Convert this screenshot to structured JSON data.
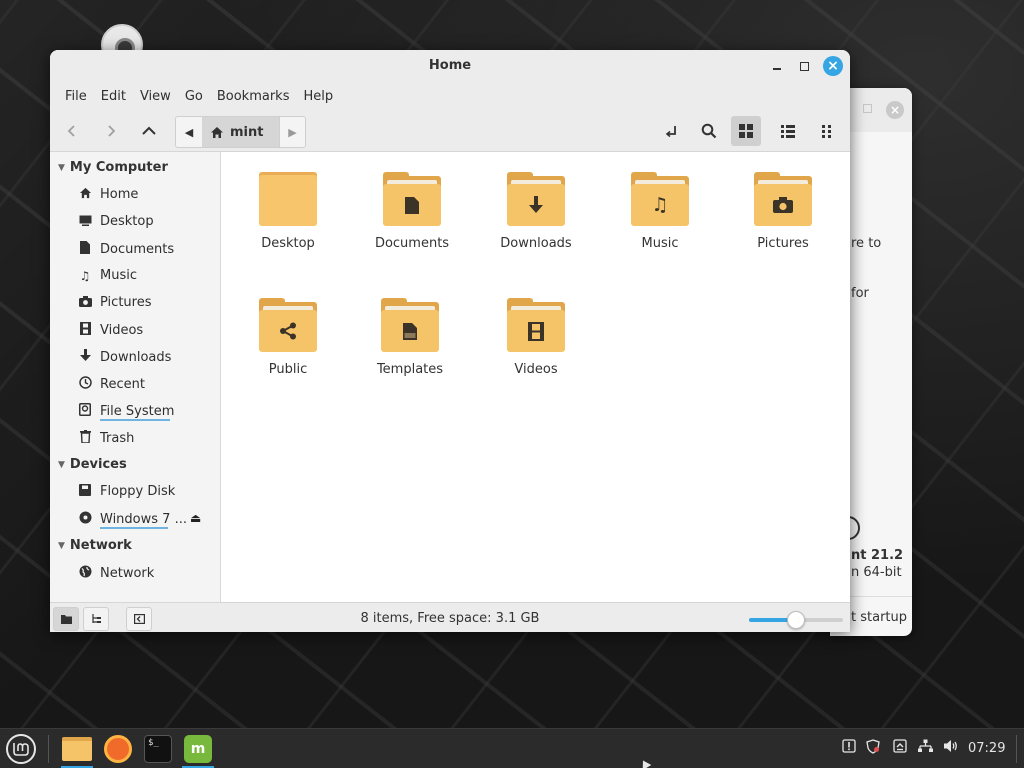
{
  "window": {
    "title": "Home",
    "controls": {
      "minimize": "minimize",
      "maximize": "maximize",
      "close": "×"
    }
  },
  "menubar": [
    "File",
    "Edit",
    "View",
    "Go",
    "Bookmarks",
    "Help"
  ],
  "toolbar": {
    "path_segment": "mint",
    "icons": [
      "back-icon",
      "forward-icon",
      "up-icon",
      "open-terminal-icon",
      "search-icon",
      "icon-view-icon",
      "list-view-icon",
      "compact-view-icon"
    ],
    "active_view": "icon-view"
  },
  "sidebar": {
    "sections": [
      {
        "title": "My Computer",
        "items": [
          {
            "label": "Home",
            "icon": "home-icon"
          },
          {
            "label": "Desktop",
            "icon": "desktop-icon"
          },
          {
            "label": "Documents",
            "icon": "document-icon"
          },
          {
            "label": "Music",
            "icon": "music-icon"
          },
          {
            "label": "Pictures",
            "icon": "camera-icon"
          },
          {
            "label": "Videos",
            "icon": "film-icon"
          },
          {
            "label": "Downloads",
            "icon": "download-icon"
          },
          {
            "label": "Recent",
            "icon": "clock-icon"
          },
          {
            "label": "File System",
            "icon": "drive-icon"
          },
          {
            "label": "Trash",
            "icon": "trash-icon"
          }
        ]
      },
      {
        "title": "Devices",
        "items": [
          {
            "label": "Floppy Disk",
            "icon": "floppy-icon"
          },
          {
            "label": "Windows 7 ...",
            "icon": "disc-icon"
          }
        ]
      },
      {
        "title": "Network",
        "items": [
          {
            "label": "Network",
            "icon": "globe-icon"
          }
        ]
      }
    ]
  },
  "files": [
    {
      "name": "Desktop",
      "icon": "folder-plain-icon"
    },
    {
      "name": "Documents",
      "icon": "folder-documents-icon"
    },
    {
      "name": "Downloads",
      "icon": "folder-downloads-icon"
    },
    {
      "name": "Music",
      "icon": "folder-music-icon"
    },
    {
      "name": "Pictures",
      "icon": "folder-pictures-icon"
    },
    {
      "name": "Public",
      "icon": "folder-public-icon"
    },
    {
      "name": "Templates",
      "icon": "folder-templates-icon"
    },
    {
      "name": "Videos",
      "icon": "folder-videos-icon"
    }
  ],
  "statusbar": {
    "text": "8 items, Free space: 3.1 GB",
    "zoom_fraction": 0.5
  },
  "background_window": {
    "fragments": [
      "re to",
      "for",
      "nt 21.2",
      "n 64-bit",
      "t startup"
    ]
  },
  "taskbar": {
    "apps": [
      "Files",
      "Firefox",
      "Terminal",
      "Mint Update"
    ],
    "terminal_glyph": "$_",
    "mint_glyph": "m",
    "clock": "07:29"
  },
  "colors": {
    "accent": "#35a5e3",
    "folder_front": "#f6c468",
    "folder_back": "#e2a64a",
    "taskbar": "#2b2b2b"
  }
}
